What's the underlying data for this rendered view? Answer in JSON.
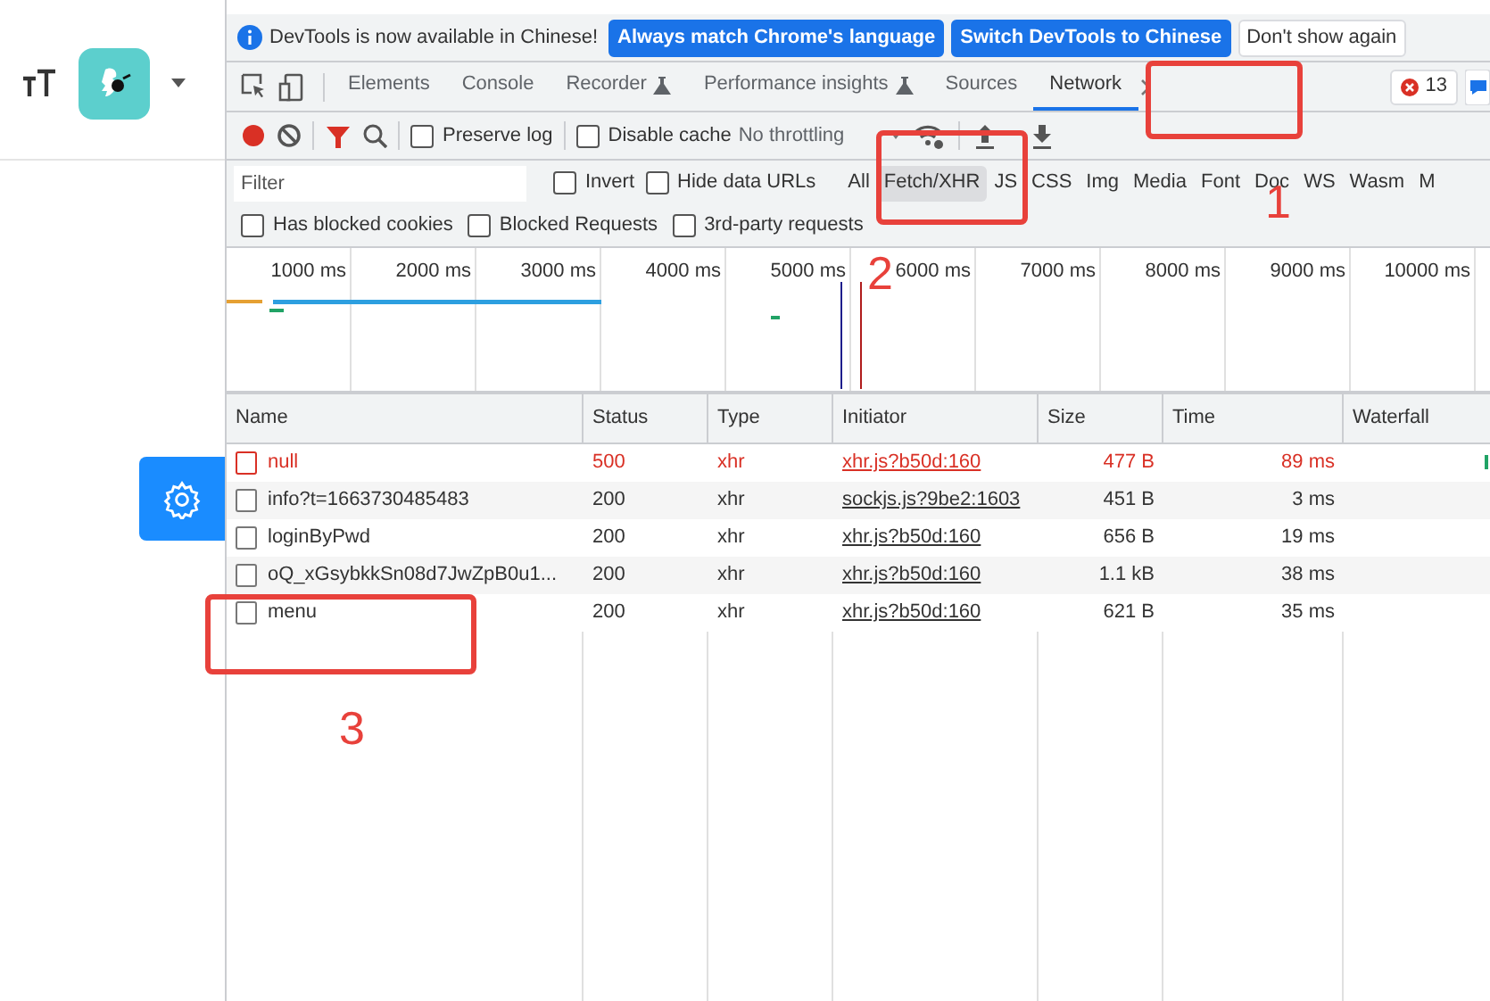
{
  "infobar": {
    "message": "DevTools is now available in Chinese!",
    "buttons": [
      {
        "label": "Always match Chrome's language",
        "kind": "primary"
      },
      {
        "label": "Switch DevTools to Chinese",
        "kind": "primary"
      },
      {
        "label": "Don't show again",
        "kind": "secondary"
      }
    ]
  },
  "tabs": [
    {
      "label": "Elements",
      "selected": false,
      "experimental": false
    },
    {
      "label": "Console",
      "selected": false,
      "experimental": false
    },
    {
      "label": "Recorder",
      "selected": false,
      "experimental": true
    },
    {
      "label": "Performance insights",
      "selected": false,
      "experimental": true
    },
    {
      "label": "Sources",
      "selected": false,
      "experimental": false
    },
    {
      "label": "Network",
      "selected": true,
      "experimental": false
    }
  ],
  "error_count": "13",
  "toolbar": {
    "recording": true,
    "filter_active": true,
    "options": [
      {
        "label": "Preserve log",
        "checked": false
      },
      {
        "label": "Disable cache",
        "checked": false
      }
    ],
    "throttling": "No throttling"
  },
  "filter": {
    "placeholder": "Filter",
    "options": [
      {
        "label": "Invert",
        "checked": false
      },
      {
        "label": "Hide data URLs",
        "checked": false
      }
    ],
    "types": [
      {
        "label": "All",
        "selected": false
      },
      {
        "label": "Fetch/XHR",
        "selected": true
      },
      {
        "label": "JS",
        "selected": false
      },
      {
        "label": "CSS",
        "selected": false
      },
      {
        "label": "Img",
        "selected": false
      },
      {
        "label": "Media",
        "selected": false
      },
      {
        "label": "Font",
        "selected": false
      },
      {
        "label": "Doc",
        "selected": false
      },
      {
        "label": "WS",
        "selected": false
      },
      {
        "label": "Wasm",
        "selected": false
      },
      {
        "label": "M",
        "selected": false
      }
    ]
  },
  "blocked_options": [
    {
      "label": "Has blocked cookies",
      "checked": false
    },
    {
      "label": "Blocked Requests",
      "checked": false
    },
    {
      "label": "3rd-party requests",
      "checked": false
    }
  ],
  "timeline_ticks": [
    "1000 ms",
    "2000 ms",
    "3000 ms",
    "4000 ms",
    "5000 ms",
    "6000 ms",
    "7000 ms",
    "8000 ms",
    "9000 ms",
    "10000 ms"
  ],
  "table": {
    "columns": [
      "Name",
      "Status",
      "Type",
      "Initiator",
      "Size",
      "Time",
      "Waterfall"
    ],
    "rows": [
      {
        "name": "null",
        "status": "500",
        "type": "xhr",
        "initiator": "xhr.js?b50d:160",
        "size": "477 B",
        "time": "89 ms",
        "error": true
      },
      {
        "name": "info?t=1663730485483",
        "status": "200",
        "type": "xhr",
        "initiator": "sockjs.js?9be2:1603",
        "size": "451 B",
        "time": "3 ms",
        "error": false
      },
      {
        "name": "loginByPwd",
        "status": "200",
        "type": "xhr",
        "initiator": "xhr.js?b50d:160",
        "size": "656 B",
        "time": "19 ms",
        "error": false
      },
      {
        "name": "oQ_xGsybkkSn08d7JwZpB0u1...",
        "status": "200",
        "type": "xhr",
        "initiator": "xhr.js?b50d:160",
        "size": "1.1 kB",
        "time": "38 ms",
        "error": false
      },
      {
        "name": "menu",
        "status": "200",
        "type": "xhr",
        "initiator": "xhr.js?b50d:160",
        "size": "621 B",
        "time": "35 ms",
        "error": false
      }
    ]
  },
  "annotations": [
    "1",
    "2",
    "3"
  ]
}
